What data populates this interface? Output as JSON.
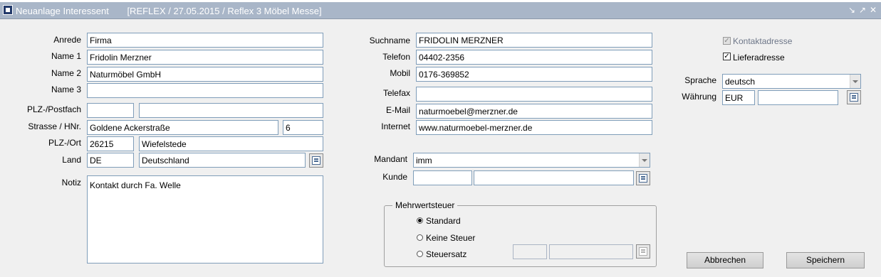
{
  "window": {
    "title": "Neuanlage Interessent",
    "subtitle": "[REFLEX / 27.05.2015 / Reflex 3 Möbel Messe]"
  },
  "left": {
    "anrede": {
      "label": "Anrede",
      "value": "Firma"
    },
    "name1": {
      "label": "Name 1",
      "value": "Fridolin Merzner"
    },
    "name2": {
      "label": "Name 2",
      "value": "Naturmöbel GmbH"
    },
    "name3": {
      "label": "Name 3",
      "value": ""
    },
    "plz_postfach": {
      "label": "PLZ-/Postfach",
      "plz": "",
      "postfach": ""
    },
    "strasse": {
      "label": "Strasse / HNr.",
      "street": "Goldene Ackerstraße",
      "number": "6"
    },
    "plz_ort": {
      "label": "PLZ-/Ort",
      "plz": "26215",
      "ort": "Wiefelstede"
    },
    "land": {
      "label": "Land",
      "code": "DE",
      "name": "Deutschland"
    },
    "notiz": {
      "label": "Notiz",
      "value": "Kontakt durch Fa. Welle"
    }
  },
  "middle": {
    "suchname": {
      "label": "Suchname",
      "value": "FRIDOLIN MERZNER"
    },
    "telefon": {
      "label": "Telefon",
      "value": "04402-2356"
    },
    "mobil": {
      "label": "Mobil",
      "value": "0176-369852"
    },
    "telefax": {
      "label": "Telefax",
      "value": ""
    },
    "email": {
      "label": "E-Mail",
      "value": "naturmoebel@merzner.de"
    },
    "internet": {
      "label": "Internet",
      "value": "www.naturmoebel-merzner.de"
    },
    "mandant": {
      "label": "Mandant",
      "value": "imm"
    },
    "kunde": {
      "label": "Kunde",
      "code": "",
      "name": ""
    }
  },
  "mwst": {
    "title": "Mehrwertsteuer",
    "options": [
      {
        "label": "Standard",
        "selected": true
      },
      {
        "label": "Keine Steuer",
        "selected": false
      },
      {
        "label": "Steuersatz",
        "selected": false
      }
    ],
    "satz_code": "",
    "satz_name": ""
  },
  "right": {
    "kontaktadresse": {
      "label": "Kontaktadresse",
      "checked": true,
      "disabled": true
    },
    "lieferadresse": {
      "label": "Lieferadresse",
      "checked": true
    },
    "sprache": {
      "label": "Sprache",
      "value": "deutsch"
    },
    "waehrung": {
      "label": "Währung",
      "code": "EUR",
      "name": ""
    }
  },
  "buttons": {
    "cancel": "Abbrechen",
    "save": "Speichern"
  },
  "colors": {
    "titlebar": "#a9b6c8",
    "field_border": "#7f9db9",
    "background": "#f0f0f0"
  }
}
